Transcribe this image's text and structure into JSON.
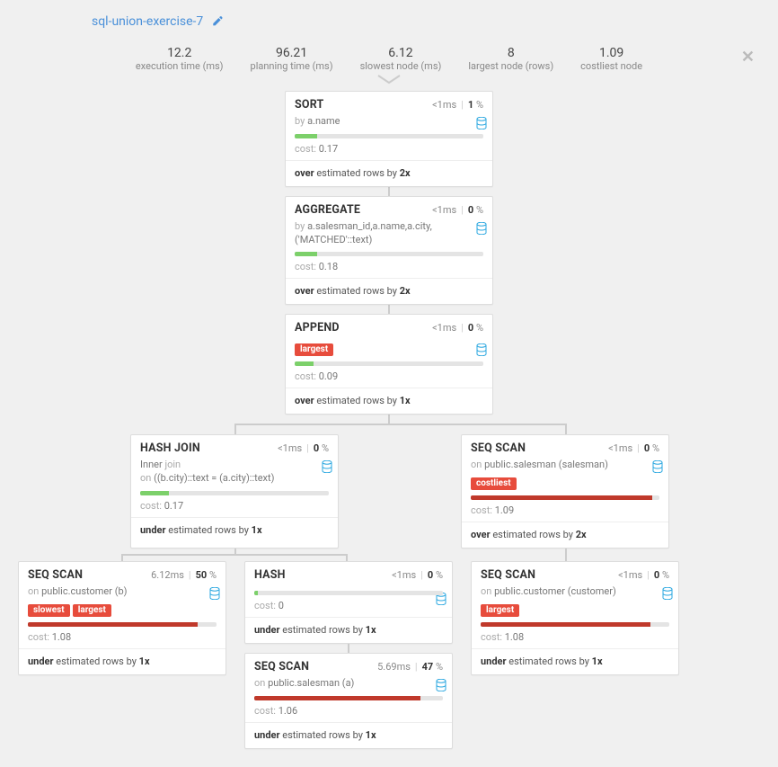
{
  "title": "sql-union-exercise-7",
  "stats": {
    "execution_time": {
      "value": "12.2",
      "label": "execution time (ms)"
    },
    "planning_time": {
      "value": "96.21",
      "label": "planning time (ms)"
    },
    "slowest_node": {
      "value": "6.12",
      "label": "slowest node (ms)"
    },
    "largest_node": {
      "value": "8",
      "label": "largest node (rows)"
    },
    "costliest_node": {
      "value": "1.09",
      "label": "costliest node"
    }
  },
  "badges": {
    "largest": "largest",
    "slowest": "slowest",
    "costliest": "costliest"
  },
  "labels": {
    "cost": "cost:",
    "by": "by",
    "on": "on",
    "over": "over",
    "under": "under",
    "estimated_rows_by": "estimated rows by",
    "join": "join"
  },
  "nodes": {
    "sort": {
      "title": "SORT",
      "time": "<1",
      "time_unit": "ms",
      "pct": "1",
      "pct_unit": "%",
      "sub": "a.name",
      "bar_pct": 12,
      "bar_color": "green",
      "cost": "0.17",
      "est_dir": "over",
      "est_factor": "2x"
    },
    "aggregate": {
      "title": "AGGREGATE",
      "time": "<1",
      "time_unit": "ms",
      "pct": "0",
      "pct_unit": "%",
      "sub": "a.salesman_id,a.name,a.city,('MATCHED'::text)",
      "bar_pct": 12,
      "bar_color": "green",
      "cost": "0.18",
      "est_dir": "over",
      "est_factor": "2x"
    },
    "append": {
      "title": "APPEND",
      "time": "<1",
      "time_unit": "ms",
      "pct": "0",
      "pct_unit": "%",
      "badges": [
        "largest"
      ],
      "bar_pct": 10,
      "bar_color": "green",
      "cost": "0.09",
      "est_dir": "over",
      "est_factor": "1x"
    },
    "hashjoin": {
      "title": "HASH JOIN",
      "time": "<1",
      "time_unit": "ms",
      "pct": "0",
      "pct_unit": "%",
      "sub1": "Inner",
      "sub2": "((b.city)::text = (a.city)::text)",
      "bar_pct": 15,
      "bar_color": "green",
      "cost": "0.17",
      "est_dir": "under",
      "est_factor": "1x"
    },
    "seqscan_salesman_r": {
      "title": "SEQ SCAN",
      "time": "<1",
      "time_unit": "ms",
      "pct": "0",
      "pct_unit": "%",
      "sub": "public.salesman (salesman)",
      "badges": [
        "costliest"
      ],
      "bar_pct": 96,
      "bar_color": "red",
      "cost": "1.09",
      "est_dir": "over",
      "est_factor": "2x"
    },
    "seqscan_customer_b": {
      "title": "SEQ SCAN",
      "time": "6.12",
      "time_unit": "ms",
      "pct": "50",
      "pct_unit": "%",
      "sub": "public.customer (b)",
      "badges": [
        "slowest",
        "largest"
      ],
      "bar_pct": 90,
      "bar_color": "red",
      "cost": "1.08",
      "est_dir": "under",
      "est_factor": "1x"
    },
    "hash": {
      "title": "HASH",
      "time": "<1",
      "time_unit": "ms",
      "pct": "0",
      "pct_unit": "%",
      "bar_pct": 2,
      "bar_color": "green",
      "cost": "0",
      "est_dir": "under",
      "est_factor": "1x"
    },
    "seqscan_customer_r": {
      "title": "SEQ SCAN",
      "time": "<1",
      "time_unit": "ms",
      "pct": "0",
      "pct_unit": "%",
      "sub": "public.customer (customer)",
      "badges": [
        "largest"
      ],
      "bar_pct": 90,
      "bar_color": "red",
      "cost": "1.08",
      "est_dir": "under",
      "est_factor": "1x"
    },
    "seqscan_salesman_a": {
      "title": "SEQ SCAN",
      "time": "5.69",
      "time_unit": "ms",
      "pct": "47",
      "pct_unit": "%",
      "sub": "public.salesman (a)",
      "bar_pct": 88,
      "bar_color": "red",
      "cost": "1.06",
      "est_dir": "under",
      "est_factor": "1x"
    }
  }
}
